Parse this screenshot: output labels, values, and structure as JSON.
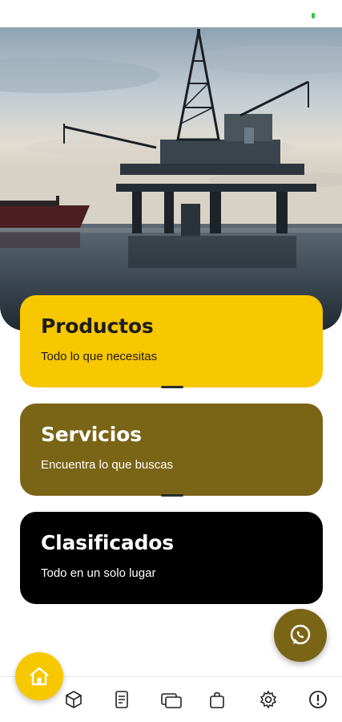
{
  "colors": {
    "productos": "#f7c700",
    "servicios": "#7a6416",
    "clasificados": "#000000",
    "whatsapp_button": "#7a6416",
    "home_button": "#f7c700"
  },
  "hero": {
    "image": "offshore-oil-platform-photo"
  },
  "cards": [
    {
      "title": "Productos",
      "subtitle": "Todo lo que necesitas"
    },
    {
      "title": "Servicios",
      "subtitle": "Encuentra lo que buscas"
    },
    {
      "title": "Clasificados",
      "subtitle": "Todo en un solo lugar"
    }
  ],
  "fab": {
    "icon": "whatsapp-icon"
  },
  "bottom_nav": {
    "items": [
      {
        "icon": "home-icon",
        "active": true
      },
      {
        "icon": "box-icon"
      },
      {
        "icon": "document-icon"
      },
      {
        "icon": "cards-icon"
      },
      {
        "icon": "shopping-bag-icon"
      },
      {
        "icon": "gear-icon"
      },
      {
        "icon": "alert-icon"
      }
    ]
  }
}
